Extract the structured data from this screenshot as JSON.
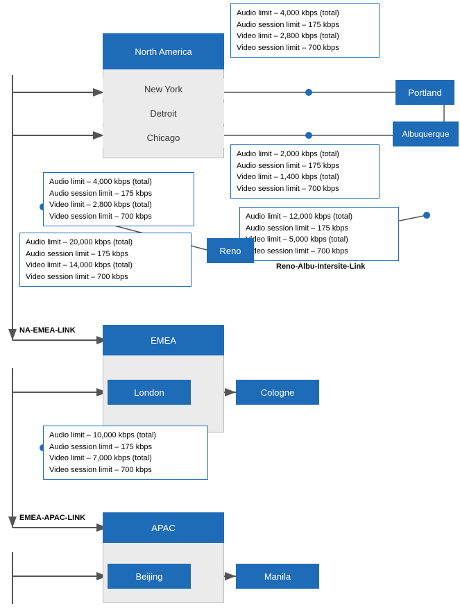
{
  "regions": {
    "north_america": {
      "label": "North America",
      "cities": [
        "New York",
        "Detroit",
        "Chicago"
      ]
    },
    "emea": {
      "label": "EMEA",
      "cities": [
        "London"
      ]
    },
    "apac": {
      "label": "APAC",
      "cities": [
        "Beijing"
      ]
    }
  },
  "nodes": {
    "portland": "Portland",
    "albuquerque": "Albuquerque",
    "reno": "Reno",
    "cologne": "Cologne",
    "manila": "Manila"
  },
  "info_boxes": {
    "top_right": {
      "lines": [
        "Audio limit – 4,000 kbps (total)",
        "Audio session limit – 175 kbps",
        "Video limit – 2,800 kbps (total)",
        "Video session limit – 700 kbps"
      ]
    },
    "mid_right_albu": {
      "lines": [
        "Audio limit – 2,000 kbps (total)",
        "Audio session limit – 175 kbps",
        "Video limit – 1,400 kbps (total)",
        "Video session limit – 700 kbps"
      ]
    },
    "reno_right": {
      "lines": [
        "Audio limit – 12,000 kbps  (total)",
        "Audio session limit – 175 kbps",
        "Video limit – 5,000 kbps (total)",
        "Video session limit – 700 kbps"
      ]
    },
    "na_left_mid": {
      "lines": [
        "Audio limit – 4,000 kbps (total)",
        "Audio session limit – 175 kbps",
        "Video limit – 2,800 kbps (total)",
        "Video session limit – 700 kbps"
      ]
    },
    "na_left_bottom": {
      "lines": [
        "Audio limit – 20,000 kbps  (total)",
        "Audio session limit – 175 kbps",
        "Video limit – 14,000 kbps  (total)",
        "Video session limit – 700 kbps"
      ]
    },
    "emea_left": {
      "lines": [
        "Audio limit – 10,000 kbps  (total)",
        "Audio session limit – 175 kbps",
        "Video limit – 7,000 kbps  (total)",
        "Video session limit – 700 kbps"
      ]
    }
  },
  "link_labels": {
    "na_emea": "NA-EMEA-LINK",
    "emea_apac": "EMEA-APAC-LINK",
    "reno_albu": "Reno-Albu-Intersite-Link"
  }
}
